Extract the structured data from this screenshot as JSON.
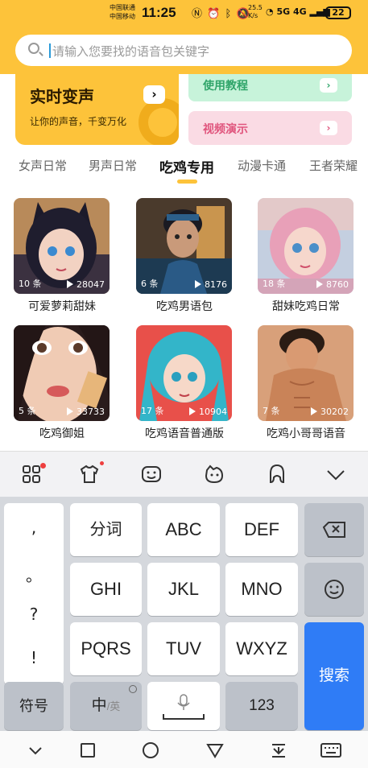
{
  "status_bar": {
    "carrier1": "中国联通",
    "carrier2": "中国移动",
    "time": "11:25",
    "net_speed_value": "25.5",
    "net_speed_unit": "K/s",
    "network": "5G  4G",
    "battery": "22"
  },
  "search": {
    "placeholder": "请输入您要找的语音包关键字"
  },
  "banners": {
    "main_title": "实时变声",
    "main_subtitle": "让你的声音，千变万化",
    "tutorial": "使用教程",
    "video_demo": "视频演示"
  },
  "tabs": [
    "女声日常",
    "男声日常",
    "吃鸡专用",
    "动漫卡通",
    "王者荣耀"
  ],
  "active_tab": "吃鸡专用",
  "packs": [
    {
      "title": "可爱萝莉甜妹",
      "count": "10 条",
      "plays": "28047"
    },
    {
      "title": "吃鸡男语包",
      "count": "6 条",
      "plays": "8176"
    },
    {
      "title": "甜妹吃鸡日常",
      "count": "18 条",
      "plays": "8760"
    },
    {
      "title": "吃鸡御姐",
      "count": "5 条",
      "plays": "33733"
    },
    {
      "title": "吃鸡语音普通版",
      "count": "17 条",
      "plays": "10904"
    },
    {
      "title": "吃鸡小哥哥语音",
      "count": "7 条",
      "plays": "30202"
    }
  ],
  "keyboard": {
    "punct": [
      ",",
      "。",
      "?",
      "!"
    ],
    "fenci": "分词",
    "abc": "ABC",
    "def": "DEF",
    "ghi": "GHI",
    "jkl": "JKL",
    "mno": "MNO",
    "pqrs": "PQRS",
    "tuv": "TUV",
    "wxyz": "WXYZ",
    "search": "搜索",
    "symbol": "符号",
    "lang_main": "中",
    "lang_sub": "/英",
    "num": "123"
  },
  "colors": {
    "brand_yellow": "#fdc33a",
    "search_key": "#2f7cf6",
    "notify_dot": "#ee3f3f"
  }
}
